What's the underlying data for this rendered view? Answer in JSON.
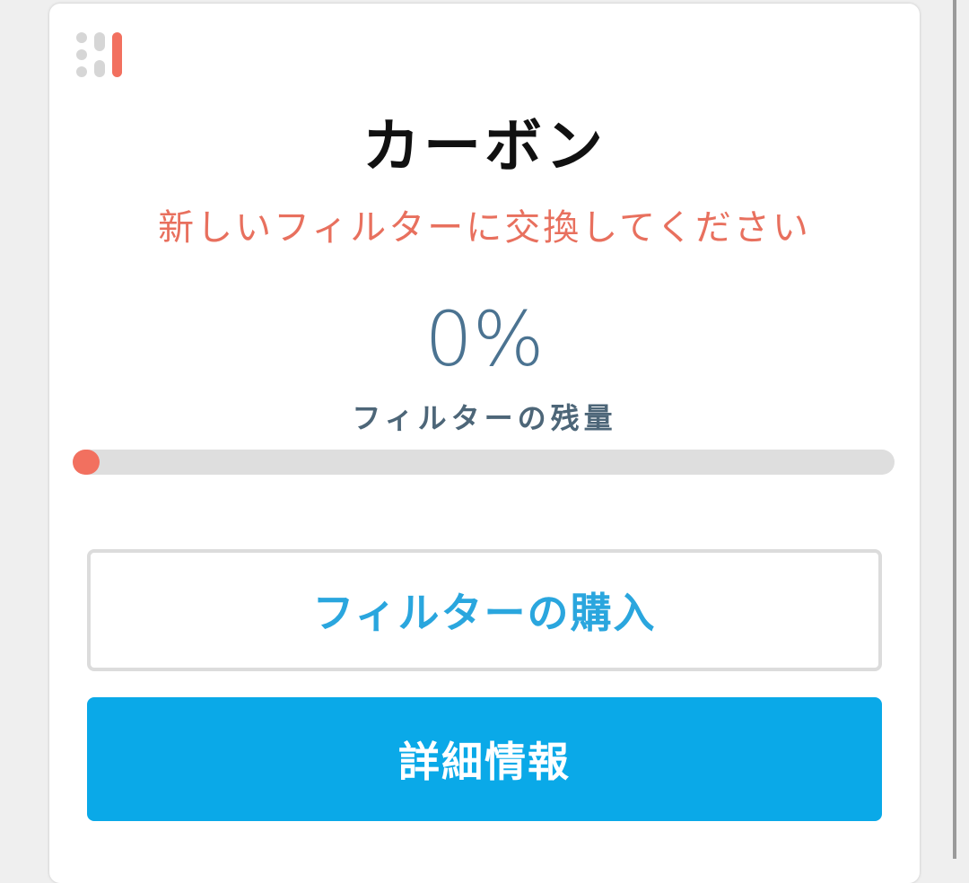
{
  "filter": {
    "title": "カーボン",
    "warning": "新しいフィルターに交換してください",
    "remaining_percent_text": "0%",
    "remaining_fraction": 0,
    "remaining_label": "フィルターの残量"
  },
  "buttons": {
    "buy_label": "フィルターの購入",
    "details_label": "詳細情報"
  },
  "colors": {
    "accent_red": "#f2705f",
    "primary_blue": "#0aa9e8",
    "link_blue": "#2aa6de",
    "percent_text": "#4b7391"
  }
}
